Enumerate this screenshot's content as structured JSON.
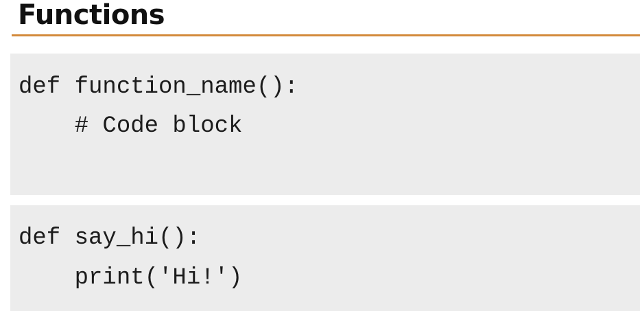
{
  "slide": {
    "title": "Functions",
    "code_blocks": [
      {
        "lines": [
          "def function_name():",
          "    # Code block"
        ]
      },
      {
        "lines": [
          "def say_hi():",
          "    print('Hi!')"
        ]
      }
    ]
  },
  "colors": {
    "title_rule": "#d38a3b",
    "code_background": "#ececec",
    "text": "#1c1c1c"
  }
}
